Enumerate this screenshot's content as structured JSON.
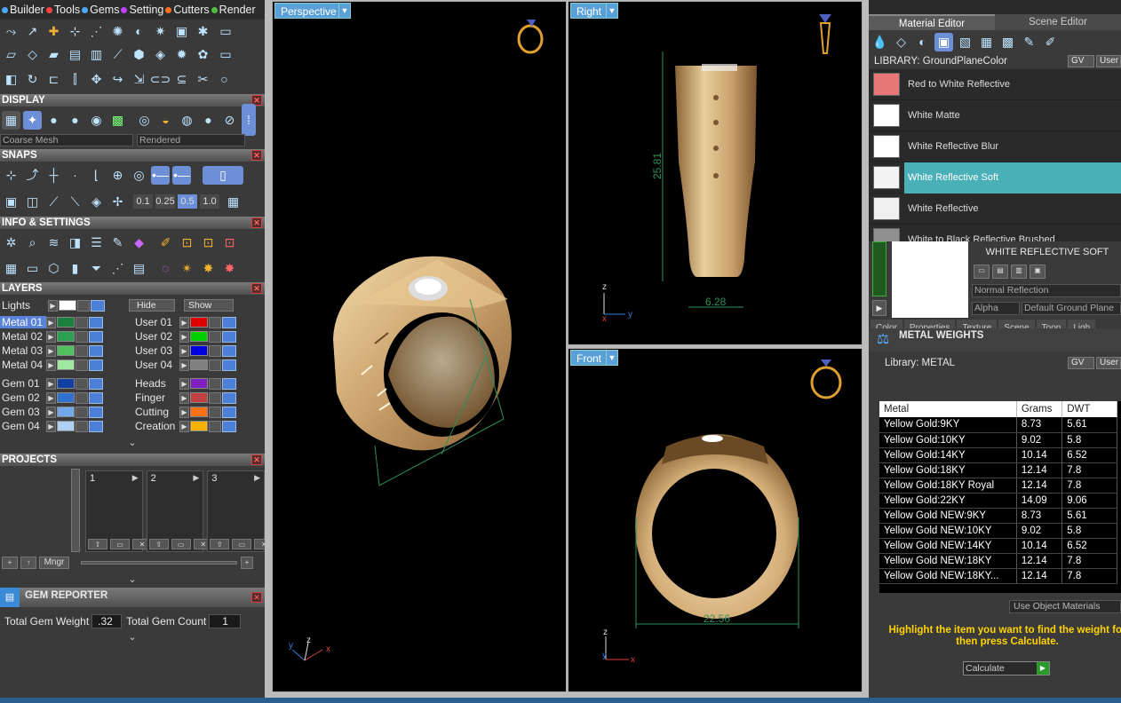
{
  "menubar": {
    "items": [
      {
        "label": "Builder",
        "color": "#4aa8ff"
      },
      {
        "label": "Tools",
        "color": "#ff4040"
      },
      {
        "label": "Gems",
        "color": "#4aa8ff"
      },
      {
        "label": "Setting",
        "color": "#c040ff"
      },
      {
        "label": "Cutters",
        "color": "#ff7020"
      },
      {
        "label": "Render",
        "color": "#50c040"
      }
    ]
  },
  "sections": {
    "display": "DISPLAY",
    "snaps": "SNAPS",
    "info": "INFO & SETTINGS",
    "layers": "LAYERS",
    "projects": "PROJECTS",
    "gem_reporter": "GEM REPORTER"
  },
  "display": {
    "mesh": "Coarse Mesh",
    "render_mode": "Rendered"
  },
  "snaps": {
    "increments": [
      "0.1",
      "0.25",
      "0.5",
      "1.0"
    ],
    "selected": "0.5"
  },
  "layers": {
    "lights_label": "Lights",
    "hide_label": "Hide",
    "show_label": "Show",
    "left": [
      {
        "name": "Metal 01",
        "color": "#1a8040",
        "selected": true
      },
      {
        "name": "Metal 02",
        "color": "#2aa050"
      },
      {
        "name": "Metal 03",
        "color": "#50c060"
      },
      {
        "name": "Metal 04",
        "color": "#a0e8a0"
      },
      {
        "name": "Gem 01",
        "color": "#1040a0"
      },
      {
        "name": "Gem 02",
        "color": "#3070d0"
      },
      {
        "name": "Gem 03",
        "color": "#70a8e8"
      },
      {
        "name": "Gem 04",
        "color": "#b0d0f0"
      }
    ],
    "right": [
      {
        "name": "User 01",
        "color": "#e00000"
      },
      {
        "name": "User 02",
        "color": "#00d000"
      },
      {
        "name": "User 03",
        "color": "#0000e0"
      },
      {
        "name": "User 04",
        "color": "#808080"
      },
      {
        "name": "Heads",
        "color": "#8020c0"
      },
      {
        "name": "Finger",
        "color": "#c04040"
      },
      {
        "name": "Cutting",
        "color": "#ff7010"
      },
      {
        "name": "Creation",
        "color": "#ffb000"
      }
    ]
  },
  "projects": {
    "slots": [
      "1",
      "2",
      "3"
    ],
    "mngr_label": "Mngr"
  },
  "gem_reporter": {
    "weight_label": "Total Gem Weight",
    "weight_value": ".32",
    "count_label": "Total Gem Count",
    "count_value": "1"
  },
  "viewports": {
    "perspective": {
      "label": "Perspective"
    },
    "right": {
      "label": "Right",
      "dim_height": "25.81",
      "dim_width": "6.28"
    },
    "front": {
      "label": "Front",
      "dim_width": "22.56"
    },
    "axis_labels": {
      "x": "x",
      "y": "y",
      "z": "z"
    }
  },
  "material_editor": {
    "tabs": [
      "Material Editor",
      "Scene Editor"
    ],
    "library_label": "LIBRARY: GroundPlaneColor",
    "gv_label": "GV",
    "user_label": "User",
    "materials": [
      {
        "name": "Red to White Reflective",
        "color": "#e87878"
      },
      {
        "name": "White Matte",
        "color": "#ffffff"
      },
      {
        "name": "White Reflective Blur",
        "color": "#ffffff"
      },
      {
        "name": "White Reflective Soft",
        "color": "#f4f4f4",
        "selected": true
      },
      {
        "name": "White Reflective",
        "color": "#f0f0f0"
      },
      {
        "name": "White to Black Reflective Brushed",
        "color": "#909090"
      }
    ],
    "preview_title": "WHITE REFLECTIVE SOFT",
    "reflection_mode": "Normal Reflection",
    "alpha_label": "Alpha",
    "ground_plane": "Default Ground Plane",
    "bottom_tabs": [
      "Color",
      "Properties",
      "Texture",
      "Scene",
      "Toon",
      "Ligh"
    ]
  },
  "metal_weights": {
    "title": "METAL WEIGHTS",
    "library": "Library: METAL",
    "columns": [
      "Metal",
      "Grams",
      "DWT"
    ],
    "rows": [
      [
        "Yellow Gold:9KY",
        "8.73",
        "5.61"
      ],
      [
        "Yellow Gold:10KY",
        "9.02",
        "5.8"
      ],
      [
        "Yellow Gold:14KY",
        "10.14",
        "6.52"
      ],
      [
        "Yellow Gold:18KY",
        "12.14",
        "7.8"
      ],
      [
        "Yellow Gold:18KY Royal",
        "12.14",
        "7.8"
      ],
      [
        "Yellow Gold:22KY",
        "14.09",
        "9.06"
      ],
      [
        "Yellow Gold NEW:9KY",
        "8.73",
        "5.61"
      ],
      [
        "Yellow Gold NEW:10KY",
        "9.02",
        "5.8"
      ],
      [
        "Yellow Gold NEW:14KY",
        "10.14",
        "6.52"
      ],
      [
        "Yellow Gold NEW:18KY",
        "12.14",
        "7.8"
      ],
      [
        "Yellow Gold NEW:18KY...",
        "12.14",
        "7.8"
      ]
    ],
    "use_object_materials": "Use Object Materials",
    "hint": "Highlight the item you want to find the weight for then press Calculate.",
    "calculate_label": "Calculate"
  }
}
